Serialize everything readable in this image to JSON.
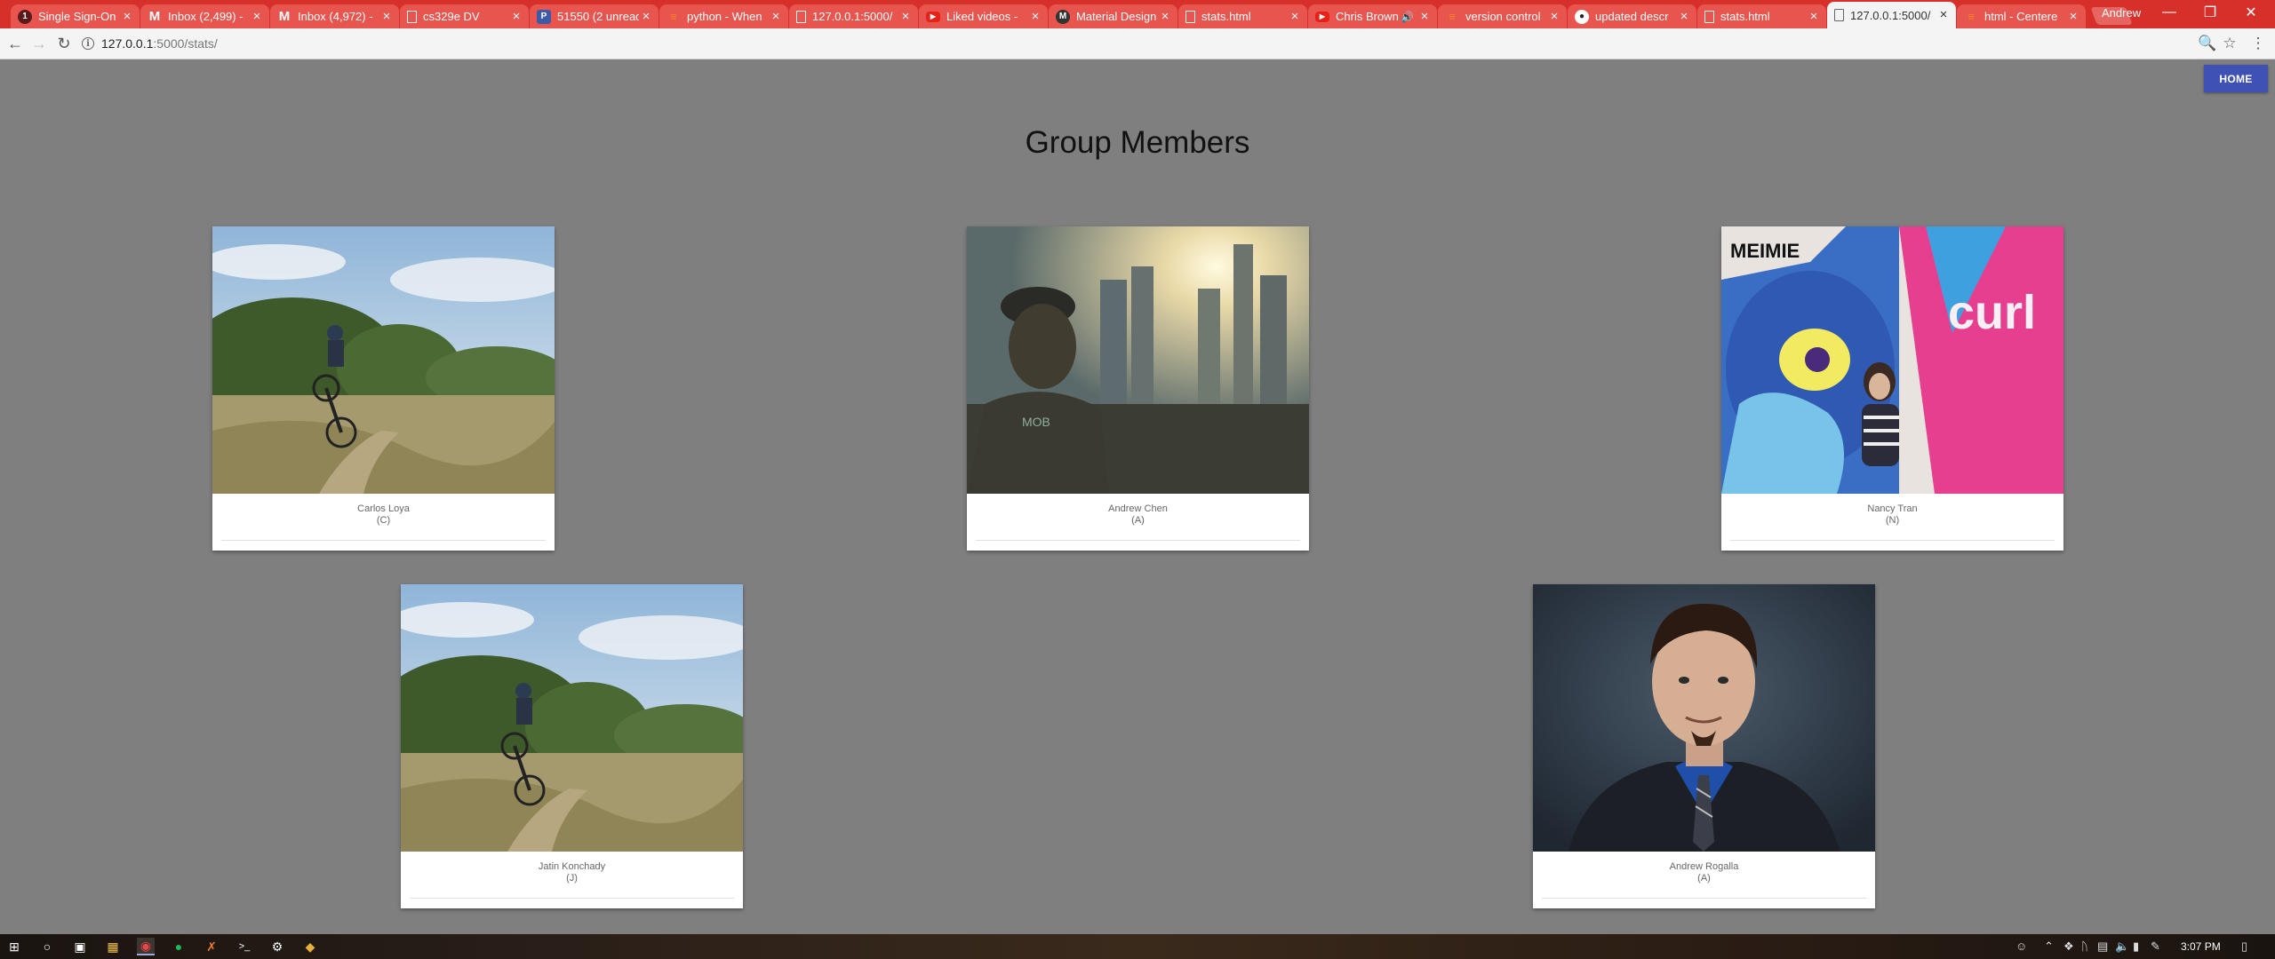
{
  "browser": {
    "tabs": [
      {
        "title": "Single Sign-On",
        "icon": "sso-icon",
        "active": false
      },
      {
        "title": "Inbox (2,499) - ",
        "icon": "gmail-icon",
        "active": false
      },
      {
        "title": "Inbox (4,972) - ",
        "icon": "gmail-icon",
        "active": false
      },
      {
        "title": "cs329e DV",
        "icon": "document-icon",
        "active": false
      },
      {
        "title": "51550 (2 unread",
        "icon": "pushbullet-icon",
        "active": false
      },
      {
        "title": "python - When ",
        "icon": "stackoverflow-icon",
        "active": false
      },
      {
        "title": "127.0.0.1:5000/",
        "icon": "document-icon",
        "active": false
      },
      {
        "title": "Liked videos - ",
        "icon": "youtube-icon",
        "active": false
      },
      {
        "title": "Material Design",
        "icon": "material-design-icon",
        "active": false
      },
      {
        "title": "stats.html",
        "icon": "document-icon",
        "active": false
      },
      {
        "title": "Chris Brown",
        "icon": "youtube-icon",
        "active": false,
        "audio": true
      },
      {
        "title": "version control",
        "icon": "stackoverflow-icon",
        "active": false
      },
      {
        "title": "updated descr",
        "icon": "github-icon",
        "active": false
      },
      {
        "title": "stats.html",
        "icon": "document-icon",
        "active": false
      },
      {
        "title": "127.0.0.1:5000/",
        "icon": "document-icon",
        "active": true
      },
      {
        "title": "html - Centere",
        "icon": "stackoverflow-icon",
        "active": false
      }
    ],
    "user_name": "Andrew",
    "url_host": "127.0.0.1",
    "url_path": ":5000/stats/",
    "tab_close_glyph": "×"
  },
  "page": {
    "home_label": "HOME",
    "title": "Group Members",
    "members": [
      {
        "name": "Carlos Loya",
        "initial": "(C)",
        "photo": "mountain-bike-trail"
      },
      {
        "name": "Andrew Chen",
        "initial": "(A)",
        "photo": "city-skyline-sunset"
      },
      {
        "name": "Nancy Tran",
        "initial": "(N)",
        "photo": "graffiti-wall"
      },
      {
        "name": "Jatin Konchady",
        "initial": "(J)",
        "photo": "mountain-bike-trail"
      },
      {
        "name": "Andrew Rogalla",
        "initial": "(A)",
        "photo": "portrait-suit"
      }
    ]
  },
  "taskbar": {
    "clock": "3:07 PM",
    "apps": [
      "windows-icon",
      "cortana-icon",
      "task-view-icon",
      "file-explorer-icon",
      "chrome-icon",
      "spotify-icon",
      "visual-studio-icon",
      "terminal-icon",
      "steam-icon",
      "git-icon"
    ]
  }
}
